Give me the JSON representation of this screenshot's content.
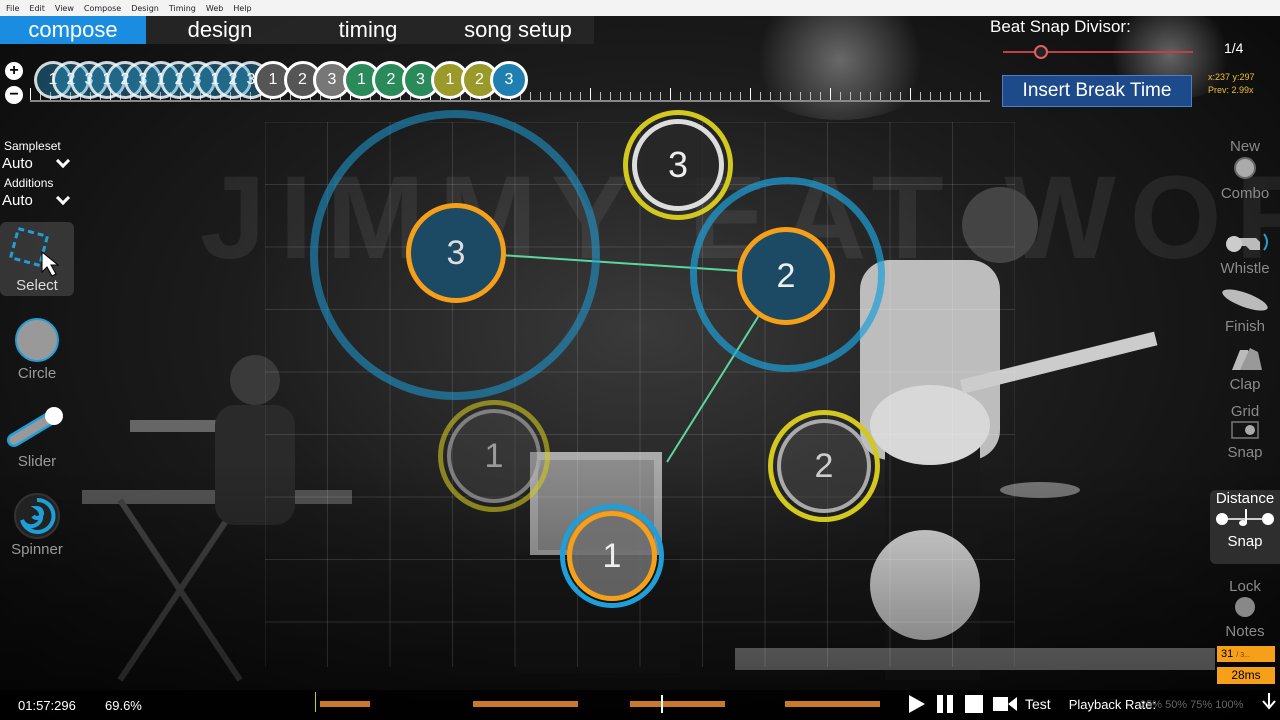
{
  "menu": [
    "File",
    "Edit",
    "View",
    "Compose",
    "Design",
    "Timing",
    "Web",
    "Help"
  ],
  "tabs": [
    {
      "label": "compose",
      "active": true
    },
    {
      "label": "design",
      "active": false
    },
    {
      "label": "timing",
      "active": false
    },
    {
      "label": "song setup",
      "active": false
    }
  ],
  "timeline": {
    "zoom_in": "+",
    "zoom_out": "−",
    "combo_numbers": [
      "1",
      "2",
      "3",
      "1",
      "2",
      "3",
      "1",
      "2",
      "3",
      "1",
      "2",
      "3",
      "1",
      "2",
      "3",
      "1",
      "2",
      "3",
      "1",
      "2",
      "3"
    ]
  },
  "beat_snap": {
    "label": "Beat Snap Divisor:",
    "value": "1/4",
    "slider_position": 0.2
  },
  "insert_break": "Insert Break Time",
  "coords": {
    "line1": "x:237 y:297",
    "line2": "Prev: 2.99x"
  },
  "sampleset": {
    "label": "Sampleset",
    "value": "Auto"
  },
  "additions": {
    "label": "Additions",
    "value": "Auto"
  },
  "left_tools": [
    {
      "label": "Select",
      "icon": "select-icon",
      "active": true
    },
    {
      "label": "Circle",
      "icon": "circle-icon",
      "active": false
    },
    {
      "label": "Slider",
      "icon": "slider-icon",
      "active": false
    },
    {
      "label": "Spinner",
      "icon": "spinner-icon",
      "active": false
    }
  ],
  "right_tools": {
    "new_combo": {
      "line1": "New",
      "line2": "Combo"
    },
    "whistle": "Whistle",
    "finish": "Finish",
    "clap": "Clap",
    "grid_snap": {
      "line1": "Grid",
      "line2": "Snap"
    },
    "distance_snap": {
      "line1": "Distance",
      "line2": "Snap"
    },
    "lock_notes": {
      "line1": "Lock",
      "line2": "Notes"
    }
  },
  "background_text": "JIMMY EAT WORLD",
  "hit_objects": [
    {
      "number": "3",
      "style": "yellow"
    },
    {
      "number": "3",
      "style": "blue-selected"
    },
    {
      "number": "2",
      "style": "blue-selected"
    },
    {
      "number": "1",
      "style": "yellow"
    },
    {
      "number": "2",
      "style": "yellow"
    },
    {
      "number": "1",
      "style": "blue-selected"
    }
  ],
  "counters": {
    "objects": "31",
    "objects_total": "/ 3... ",
    "latency": "28ms"
  },
  "bottom": {
    "time": "01:57:296",
    "percent": "69.6%",
    "test": "Test",
    "playback_rate": "Playback Rate:",
    "rate_options": "25%  50%  75%  100%",
    "progress_fraction": 0.696
  },
  "colors": {
    "accent": "#1a8de0",
    "orange": "#f5a018",
    "yellow_ring": "#d2c81e",
    "blue_ring": "#1e9fd9"
  }
}
